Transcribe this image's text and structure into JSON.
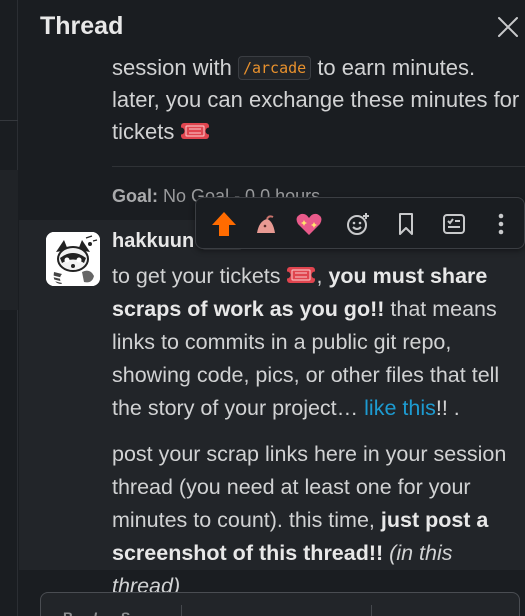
{
  "header": {
    "title": "Thread",
    "close_icon": "close-icon"
  },
  "top_message": {
    "line1_pre": "session with",
    "command": "/arcade",
    "line1_post": "to earn minutes.",
    "line2": "later, you can exchange these minutes for",
    "line3": "tickets",
    "ticket_emoji": "admission-ticket"
  },
  "goal": {
    "label": "Goal:",
    "value": "No Goal - 0.0 hours"
  },
  "toolbar": {
    "buttons": [
      "upvote-icon",
      "emoji-reaction-icon",
      "sparkling-heart-icon",
      "add-reaction-icon",
      "bookmark-icon",
      "add-to-list-icon",
      "more-actions-icon"
    ],
    "colors": {
      "upvote": "#ff6b00",
      "heart": "#e85a8a"
    }
  },
  "message": {
    "author": "hakkuun",
    "meta": "subtitle",
    "p1_a": "to get your tickets",
    "p1_bold": "you must share scraps of work as you go!!",
    "p1_b": "that means links to commits in a public git repo, showing code, pics, or other files that tell the story of your project…",
    "p1_link": "like this",
    "p1_end": "!! .",
    "p2_a": "post your scrap links here in your session thread (you need at least one for your minutes to count). this time,",
    "p2_bold": "just post a screenshot of this thread!!",
    "p2_italic": "(in this thread)"
  },
  "composer": {
    "tools": [
      "B",
      "I",
      "S"
    ]
  },
  "colors": {
    "background": "#1a1d21",
    "hover_row": "#222529",
    "link": "#1d9bd1",
    "code": "#e8912d"
  }
}
